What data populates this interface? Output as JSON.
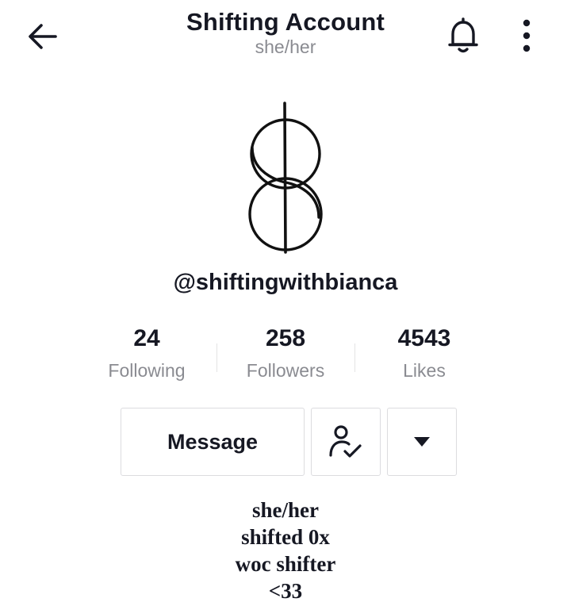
{
  "header": {
    "title": "Shifting Account",
    "subtitle": "she/her",
    "back_icon": "arrow-left-icon",
    "bell_icon": "bell-icon",
    "more_icon": "more-vertical-icon"
  },
  "profile": {
    "avatar_icon": "shifting-symbol-logo",
    "username": "@shiftingwithbianca"
  },
  "stats": [
    {
      "value": "24",
      "label": "Following"
    },
    {
      "value": "258",
      "label": "Followers"
    },
    {
      "value": "4543",
      "label": "Likes"
    }
  ],
  "actions": {
    "message_label": "Message",
    "friend_icon": "user-check-icon",
    "dropdown_icon": "caret-down-icon"
  },
  "bio": {
    "lines": [
      "she/her",
      "shifted 0x",
      "woc shifter",
      "<33"
    ]
  },
  "colors": {
    "text_primary": "#161823",
    "text_secondary": "#8a8b91",
    "border": "#dcdcdf"
  }
}
